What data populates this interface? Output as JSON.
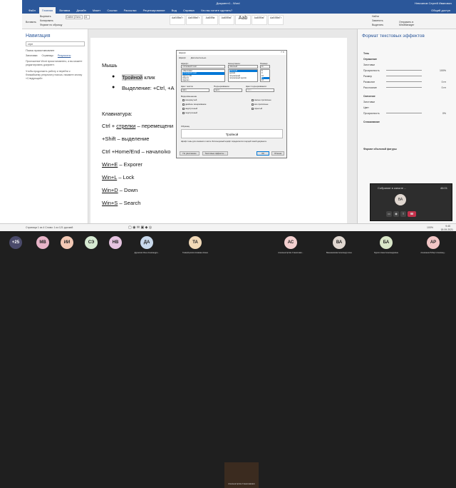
{
  "window": {
    "title": "Документ1 - Word",
    "user": "Немчинов Сергей Иванович",
    "share": "Общий доступ"
  },
  "ribbon": {
    "tabs": [
      "Файл",
      "Главная",
      "Вставка",
      "Дизайн",
      "Макет",
      "Ссылки",
      "Рассылки",
      "Рецензирование",
      "Вид",
      "Справка",
      "Что вы хотите сделать?"
    ],
    "paste": "Вставить",
    "cut": "Вырезать",
    "copy": "Копировать",
    "format": "Формат по образцу",
    "font": "Calibri (Осно",
    "size": "11",
    "styles": [
      "АаБбВвГг",
      "АаБбВвГг",
      "АаБбВв",
      "АаБбВвГ",
      "Ааb",
      "АаБбВвГ",
      "АаБбВвГг"
    ],
    "find": "Найти",
    "replace": "Заменить",
    "select": "Выделить",
    "minddesk": "Отправить в MindManager"
  },
  "nav": {
    "title": "Навигация",
    "search": "стрл",
    "caption": "Поиск приостановлен",
    "tabs": [
      "Заголовки",
      "Страницы",
      "Результаты"
    ],
    "msg1": "Приложение Word приостановлено, а вы можете редактировать документ.",
    "msg2": "Чтобы продолжить работу и перейти к ближайшему результату поиска, нажмите кнопку «Следующий»."
  },
  "doc": {
    "l1": "Мышь",
    "b1a": "Тройной",
    "b1b": " клик",
    "b2": "Выделение: +Ctrl, +A",
    "l2": "Клавиатура:",
    "l3a": "Ctrl + ",
    "l3b": "стрелки",
    "l3c": " – перемещени",
    "l4": "+Shift – выделение",
    "l5": "Ctrl +Home/End – начало/ко",
    "l6a": "Win+E",
    "l6b": " – Exporer",
    "l7a": "Win+L",
    "l7b": " – Lock",
    "l8a": "Win+D",
    "l8b": " – Down",
    "l9a": "Win+S",
    "l9b": " – Search"
  },
  "dialog": {
    "title": "Шрифт",
    "tabs": [
      "Шрифт",
      "Дополнительно"
    ],
    "font_label": "Шрифт:",
    "style_label": "Начертание:",
    "size_label": "Размер:",
    "font_value": "+Основной текст",
    "style_value": "обычный",
    "size_value": "11",
    "fonts": [
      "+Заголовки",
      "+Основной текст",
      "Agency FB",
      "Aharoni",
      "Algerian"
    ],
    "styles": [
      "обычный",
      "курсив",
      "полужирный",
      "полужирный курсив"
    ],
    "sizes": [
      "8",
      "9",
      "10",
      "11",
      "12"
    ],
    "color_label": "Цвет текста:",
    "underline_label": "Подчеркивание:",
    "ucolor_label": "Цвет подчеркивания:",
    "color_value": "Авто",
    "underline_value": "(нет)",
    "ucolor_value": "Авто",
    "effects_label": "Видоизменение",
    "effects_left": [
      "зачеркнутый",
      "двойное зачеркивание",
      "надстрочный",
      "подстрочный"
    ],
    "effects_right": [
      "малые прописные",
      "все прописные",
      "скрытый"
    ],
    "sample_label": "Образец",
    "sample": "Тройной",
    "note": "Шрифт темы для основного текста. Используемый шрифт определяется текущей темой документа.",
    "btn_default": "По умолчанию",
    "btn_effects": "Текстовые эффекты...",
    "btn_ok": "ОК",
    "btn_cancel": "Отмена"
  },
  "rpane": {
    "title": "Формат текстовых эффектов",
    "sections": [
      "Тень",
      "Отражение",
      "Заготовки",
      "Прозрачность",
      "Размер",
      "Размытие",
      "Расстояние",
      "Свечение",
      "Заготовки",
      "Цвет",
      "Прозрачность",
      "Сглаживание",
      "Формат объемной фигуры"
    ],
    "vals": [
      "100%",
      "0 пт",
      "0 пт",
      "0%"
    ]
  },
  "status": {
    "text": "Страница 1 из 4   Слово: 1 из 121   русский",
    "zoom": "100%",
    "time": "9:45",
    "date": "18.09.2021"
  },
  "meeting": {
    "title": "Собрание в канале ...",
    "time": "46:01",
    "initials": "ВА"
  },
  "participants": [
    {
      "i": "+25",
      "n": "",
      "color": "#4a4a6a"
    },
    {
      "i": "МВ",
      "n": "",
      "color": "#e8b4c8"
    },
    {
      "i": "ИИ",
      "n": "",
      "color": "#f3c9b5"
    },
    {
      "i": "СЭ",
      "n": "",
      "color": "#d6ead2"
    },
    {
      "i": "НВ",
      "n": "",
      "color": "#e5c3e0"
    },
    {
      "i": "ДА",
      "n": "Дурнилов Илья Александро...",
      "color": "#c9d9ec"
    },
    {
      "i": "ТА",
      "n": "Тимирбулатов Алиаман Асмехан...",
      "color": "#f1d9b7"
    },
    {
      "i": "",
      "n": "Алексеев Артём Станиславович",
      "color": "#3b2b1f"
    },
    {
      "i": "АС",
      "n": "Алексеев Артём Станиславо...",
      "color": "#f3cfcf"
    },
    {
      "i": "ВА",
      "n": "Вашемникова Александр Алексе...",
      "color": "#e0d7d0"
    },
    {
      "i": "БА",
      "n": "Бурлич Анна Александровна",
      "color": "#d9e6c8"
    },
    {
      "i": "АР",
      "n": "Алексанян Роберт Александ...",
      "color": "#f2c6c6"
    }
  ]
}
